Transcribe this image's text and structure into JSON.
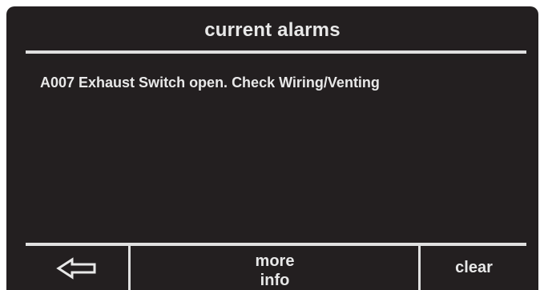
{
  "header": {
    "title": "current alarms"
  },
  "alarms": [
    {
      "text": "A007 Exhaust Switch open. Check Wiring/Venting"
    }
  ],
  "footer": {
    "back_icon": "left-arrow-icon",
    "more_info_label": "more\ninfo",
    "clear_label": "clear"
  },
  "colors": {
    "background": "#231f20",
    "text": "#e8e8e8",
    "rules": "#e0e0e0"
  }
}
